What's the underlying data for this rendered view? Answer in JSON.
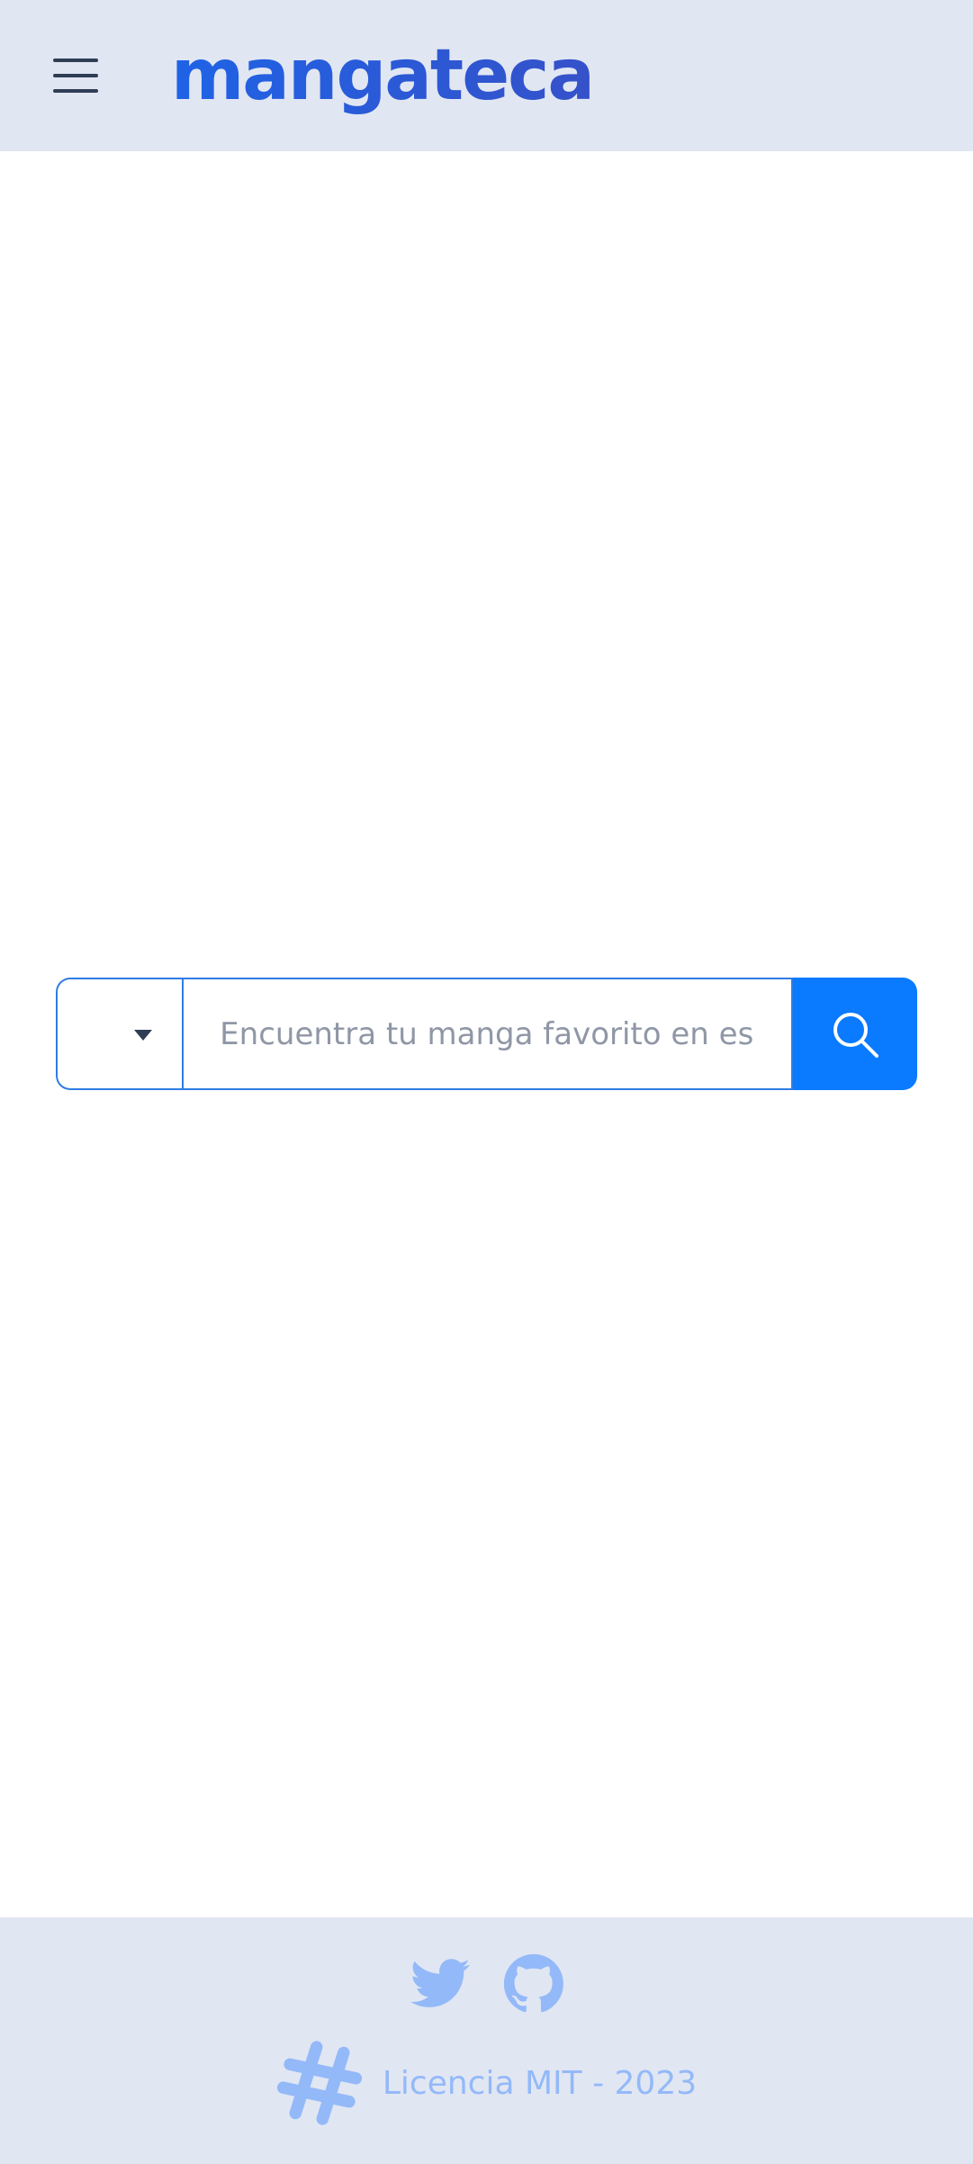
{
  "header": {
    "logo_text": "mangateca"
  },
  "search": {
    "placeholder": "Encuentra tu manga favorito en esp",
    "select_value": ""
  },
  "footer": {
    "license_text": "Licencia MIT - 2023"
  },
  "colors": {
    "header_bg": "#e1e6f3",
    "accent": "#0a7aff",
    "logo": "#2d5bd9",
    "footer_icon": "#93b9f8"
  },
  "icons": {
    "menu": "hamburger-icon",
    "select": "caret-down-icon",
    "search": "search-icon",
    "twitter": "twitter-icon",
    "github": "github-icon",
    "license": "hashtag-icon"
  }
}
